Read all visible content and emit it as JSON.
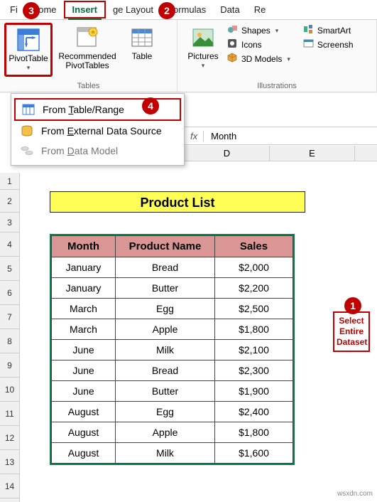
{
  "tabs": {
    "file": "Fi",
    "home": "Home",
    "insert": "Insert",
    "pagelayout": "ge Layout",
    "formulas": "Formulas",
    "data": "Data",
    "review": "Re"
  },
  "ribbon": {
    "pivottable": "PivotTable",
    "recommended": "Recommended\nPivotTables",
    "table": "Table",
    "tables_group": "Tables",
    "pictures": "Pictures",
    "shapes": "Shapes",
    "icons": "Icons",
    "models": "3D Models",
    "smartart": "SmartArt",
    "screenshot": "Screensh",
    "illustrations_group": "Illustrations"
  },
  "dropdown": {
    "from_table": "From Table/Range",
    "from_external": "From External Data Source",
    "from_model": "From Data Model"
  },
  "formula_bar": {
    "fx": "fx",
    "value": "Month",
    "name_box": " "
  },
  "col_headers": [
    "D",
    "E"
  ],
  "row_headers": [
    "1",
    "2",
    "3",
    "4",
    "5",
    "6",
    "7",
    "8",
    "9",
    "10",
    "11",
    "12",
    "13",
    "14"
  ],
  "title": "Product List",
  "table": {
    "headers": [
      "Month",
      "Product Name",
      "Sales"
    ],
    "rows": [
      [
        "January",
        "Bread",
        "$2,000"
      ],
      [
        "January",
        "Butter",
        "$2,200"
      ],
      [
        "March",
        "Egg",
        "$2,500"
      ],
      [
        "March",
        "Apple",
        "$1,800"
      ],
      [
        "June",
        "Milk",
        "$2,100"
      ],
      [
        "June",
        "Bread",
        "$2,300"
      ],
      [
        "June",
        "Butter",
        "$1,900"
      ],
      [
        "August",
        "Egg",
        "$2,400"
      ],
      [
        "August",
        "Apple",
        "$1,800"
      ],
      [
        "August",
        "Milk",
        "$1,600"
      ]
    ]
  },
  "annotation": "Select Entire Dataset",
  "callouts": {
    "c1": "1",
    "c2": "2",
    "c3": "3",
    "c4": "4"
  },
  "watermark": "wsxdn.com"
}
